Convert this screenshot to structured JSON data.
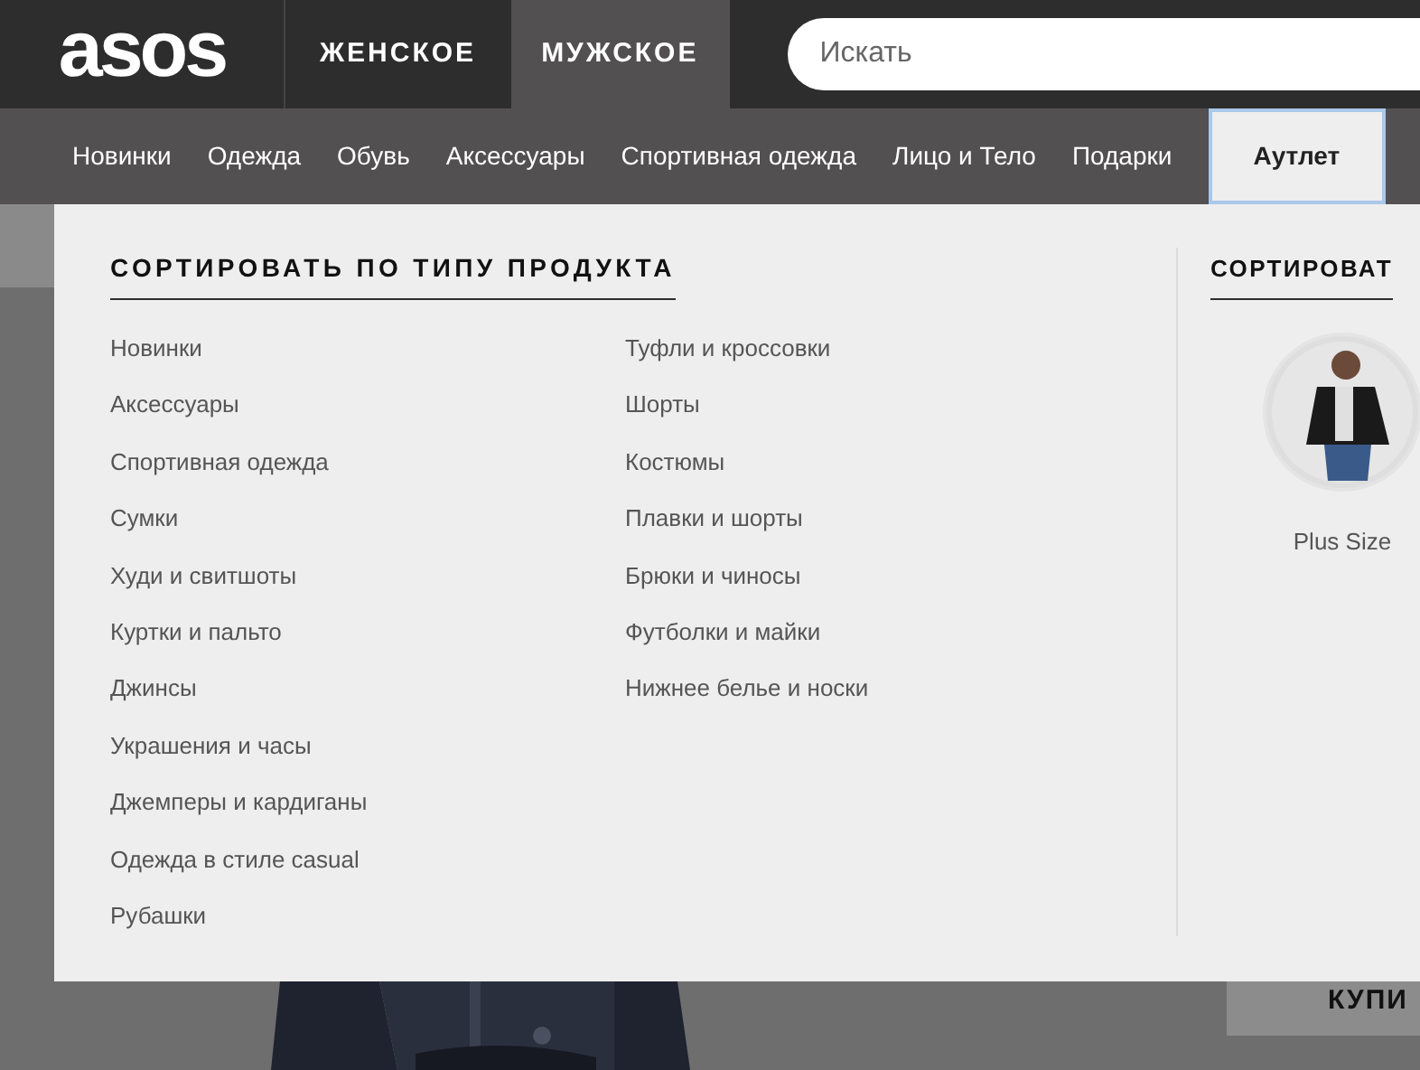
{
  "header": {
    "logo": "asos",
    "gender_tabs": [
      {
        "label": "ЖЕНСКОЕ",
        "selected": false
      },
      {
        "label": "МУЖСКОЕ",
        "selected": true
      }
    ],
    "search": {
      "placeholder": "Искать"
    }
  },
  "nav": [
    {
      "label": "Новинки",
      "selected": false
    },
    {
      "label": "Одежда",
      "selected": false
    },
    {
      "label": "Обувь",
      "selected": false
    },
    {
      "label": "Аксессуары",
      "selected": false
    },
    {
      "label": "Спортивная одежда",
      "selected": false
    },
    {
      "label": "Лицо и Тело",
      "selected": false
    },
    {
      "label": "Подарки",
      "selected": false
    },
    {
      "label": "Аутлет",
      "selected": true
    }
  ],
  "dropdown": {
    "product_type": {
      "heading": "СОРТИРОВАТЬ ПО ТИПУ ПРОДУКТА",
      "columns": [
        [
          "Новинки",
          "Аксессуары",
          "Спортивная одежда",
          "Сумки",
          "Худи и свитшоты",
          "Куртки и пальто",
          "Джинсы",
          "Украшения и часы",
          "Джемперы и кардиганы",
          "Одежда в стиле casual",
          "Рубашки"
        ],
        [
          "Туфли и кроссовки",
          "Шорты",
          "Костюмы",
          "Плавки и шорты",
          "Брюки и чиносы",
          "Футболки и майки",
          "Нижнее белье и носки"
        ]
      ]
    },
    "section_2": {
      "heading": "СОРТИРОВАТ",
      "items": [
        {
          "label": "Plus Size",
          "kind": "picture"
        }
      ]
    }
  },
  "background": {
    "button": "КУПИ"
  }
}
